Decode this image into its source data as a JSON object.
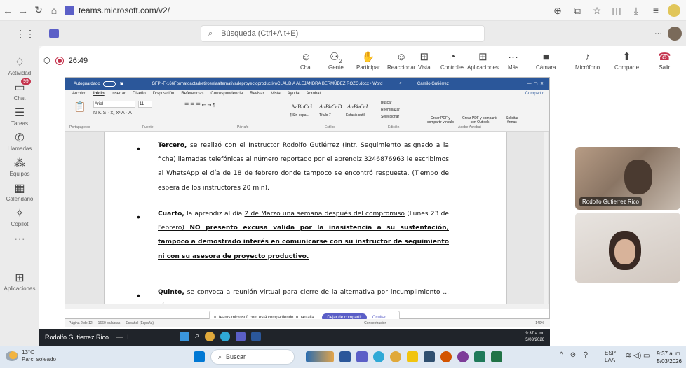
{
  "browser": {
    "url": "teams.microsoft.com/v2/",
    "nav_icons": [
      "back-icon",
      "forward-icon",
      "reload-icon",
      "home-icon"
    ],
    "right_icons": [
      "zoom-icon",
      "install-icon",
      "star-icon",
      "extensions-icon",
      "downloads-icon",
      "menu-icon"
    ]
  },
  "teams": {
    "search_placeholder": "Búsqueda (Ctrl+Alt+E)",
    "rail": [
      {
        "label": "Actividad",
        "icon": "bell-icon"
      },
      {
        "label": "Chat",
        "icon": "chat-icon",
        "badge": "99"
      },
      {
        "label": "Tareas",
        "icon": "tasks-icon"
      },
      {
        "label": "Llamadas",
        "icon": "phone-icon"
      },
      {
        "label": "Equipos",
        "icon": "teams-icon"
      },
      {
        "label": "Calendario",
        "icon": "calendar-icon"
      },
      {
        "label": "Copilot",
        "icon": "copilot-icon"
      },
      {
        "label": "",
        "icon": "more-icon"
      },
      {
        "label": "Aplicaciones",
        "icon": "apps-icon"
      }
    ]
  },
  "call": {
    "timer": "26:49",
    "controls": [
      {
        "label": "Chat",
        "icon": "chat-icon"
      },
      {
        "label": "Gente",
        "icon": "people-icon",
        "count": "2"
      },
      {
        "label": "Participar",
        "icon": "raise-hand-icon"
      },
      {
        "label": "Reaccionar",
        "icon": "emoji-icon"
      },
      {
        "label": "Vista",
        "icon": "view-icon"
      },
      {
        "label": "Controles",
        "icon": "controls-icon"
      },
      {
        "label": "Aplicaciones",
        "icon": "add-app-icon"
      },
      {
        "label": "Más",
        "icon": "more-icon"
      },
      {
        "label": "Cámara",
        "icon": "camera-icon"
      },
      {
        "label": "Micrófono",
        "icon": "mic-icon"
      },
      {
        "label": "Comparte",
        "icon": "share-icon"
      },
      {
        "label": "Salir",
        "icon": "leave-icon"
      }
    ],
    "participants": [
      {
        "name": "Rodolfo Gutierrez Rico"
      },
      {
        "name": ""
      }
    ],
    "presenter_bar": "Rodolfo Gutierrez Rico",
    "share_banner": {
      "text": "teams.microsoft.com está compartiendo tu pantalla.",
      "stop": "Dejar de compartir",
      "hide": "Ocultar"
    }
  },
  "word": {
    "autosave": "Autoguardado",
    "filename": "GFPI-F-166FormatoactadretiroenlaalternativadeproyectoproductivoCLAUDIA ALEJANDRA BERMÚDEZ ROZO.docx • Word",
    "user": "Camilo Gutiérrez",
    "tabs": [
      "Archivo",
      "Inicio",
      "Insertar",
      "Diseño",
      "Disposición",
      "Referencias",
      "Correspondencia",
      "Revisar",
      "Vista",
      "Ayuda",
      "Acrobat"
    ],
    "share_label": "Compartir",
    "font": "Arial",
    "font_size": "11",
    "groups": [
      "Portapapeles",
      "Fuente",
      "Párrafo",
      "Estilos",
      "Edición",
      "Adobe Acrobat"
    ],
    "styles": [
      "AaBbCcI",
      "AaBbCcD",
      "AaBbCcI"
    ],
    "style_names": [
      "¶ Sin espa...",
      "Título 7",
      "Énfasis sutil"
    ],
    "edit": [
      "Buscar",
      "Reemplazar",
      "Seleccionar"
    ],
    "acrobat": [
      "Crear PDF y compartir vínculo",
      "Crear PDF y compartir con Outlook",
      "Solicitar firmas"
    ],
    "status": {
      "page": "Página 2 de 12",
      "words": "1660 palabras",
      "lang": "Español (España)",
      "focus": "Concentración",
      "zoom": "140%"
    }
  },
  "document": {
    "p1": {
      "bold": "Tercero,",
      "text": " se realizó con el Instructor Rodolfo Gutiérrez (Intr. Seguimiento asignado a la ficha) llamadas telefónicas al número reportado por el aprendiz 3246876963 le escribimos al WhatsApp el día de 18",
      "underlined": " de febrero ",
      "text2": "donde tampoco se encontró respuesta. (Tiempo de espera de los instructores 20 min)."
    },
    "p2": {
      "bold": "Cuarto,",
      "text": " la aprendiz al día ",
      "u1": "2 de Marzo una semana después del compromiso",
      "text2": " (Lunes 23 de ",
      "u2": "Febrero)",
      "bold_u": " NO  presento excusa valida por la inasistencia a su sustentación, tampoco a demostrado interés en comunicarse con su instructor de seguimiento ni con su asesora de proyecto productivo."
    },
    "p3": {
      "bold": "Quinto,",
      "text": " se convoca a reunión virtual para cierre de la alternativa por incumplimiento ... día que expresa"
    }
  },
  "taskbar": {
    "weather_temp": "13°C",
    "weather_desc": "Parc. soleado",
    "search": "Buscar",
    "lang": "ESP",
    "lang2": "LAA",
    "time": "9:37 a. m.",
    "date": "5/03/2026",
    "inner_time": "9:37 a. m.",
    "inner_date": "5/03/2026"
  }
}
